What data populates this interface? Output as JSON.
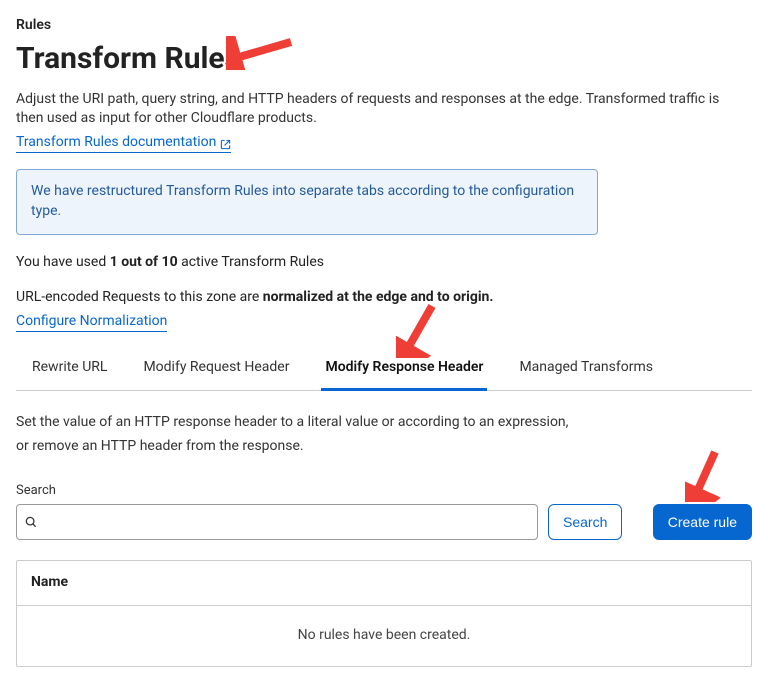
{
  "breadcrumb": "Rules",
  "page_title": "Transform Rules",
  "description": "Adjust the URI path, query string, and HTTP headers of requests and responses at the edge. Transformed traffic is then used as input for other Cloudflare products.",
  "doc_link_label": "Transform Rules documentation",
  "notice": "We have restructured Transform Rules into separate tabs according to the configuration type.",
  "usage": {
    "prefix": "You have used ",
    "count": "1 out of 10",
    "suffix": " active Transform Rules"
  },
  "normalization": {
    "prefix": "URL-encoded Requests to this zone are ",
    "strong": "normalized at the edge and to origin.",
    "config_label": "Configure Normalization"
  },
  "tabs": [
    {
      "label": "Rewrite URL",
      "active": false
    },
    {
      "label": "Modify Request Header",
      "active": false
    },
    {
      "label": "Modify Response Header",
      "active": true
    },
    {
      "label": "Managed Transforms",
      "active": false
    }
  ],
  "tab_desc": {
    "line1": "Set the value of an HTTP response header to a literal value or according to an expression,",
    "line2": "or remove an HTTP header from the response."
  },
  "search": {
    "label": "Search",
    "placeholder": "",
    "button": "Search"
  },
  "create_button": "Create rule",
  "table": {
    "header_name": "Name",
    "empty": "No rules have been created."
  }
}
